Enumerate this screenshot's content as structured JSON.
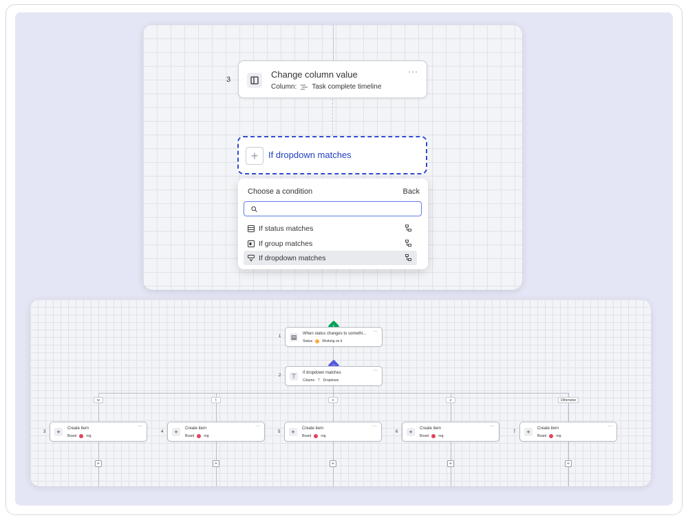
{
  "top": {
    "step": {
      "number": "3",
      "title": "Change column value",
      "column_label": "Column:",
      "column_value": "Task complete timeline",
      "more": "···"
    },
    "condition_card": {
      "label": "If dropdown matches",
      "plus": "+"
    },
    "dropdown": {
      "header": "Choose a condition",
      "back": "Back",
      "search_placeholder": "",
      "options": [
        {
          "label": "If status matches",
          "icon": "status-icon"
        },
        {
          "label": "If group matches",
          "icon": "group-icon"
        },
        {
          "label": "If dropdown matches",
          "icon": "dropdown-icon",
          "highlighted": true
        }
      ]
    }
  },
  "bottom": {
    "trigger": {
      "number": "1",
      "title": "When status changes to somethi...",
      "sub_label": "Status",
      "sub_value": "Working on it",
      "status_color": "#fdab3d",
      "badge_color": "#00a359",
      "more": "···"
    },
    "condition": {
      "number": "2",
      "title": "If dropdown matches",
      "sub_label": "Column",
      "sub_value": "Dropdown",
      "badge_color": "#5559df",
      "more": "···"
    },
    "branch_tags": [
      "w",
      "t",
      "x",
      "z",
      "Otherwise"
    ],
    "actions": [
      {
        "number": "3",
        "title": "Create item",
        "sub_label": "Board",
        "sub_value": "reg"
      },
      {
        "number": "4",
        "title": "Create item",
        "sub_label": "Board",
        "sub_value": "reg"
      },
      {
        "number": "5",
        "title": "Create item",
        "sub_label": "Board",
        "sub_value": "reg"
      },
      {
        "number": "6",
        "title": "Create item",
        "sub_label": "Board",
        "sub_value": "reg"
      },
      {
        "number": "7",
        "title": "Create item",
        "sub_label": "Board",
        "sub_value": "reg"
      }
    ],
    "board_color": "#e2445c",
    "add_symbol": "+"
  }
}
